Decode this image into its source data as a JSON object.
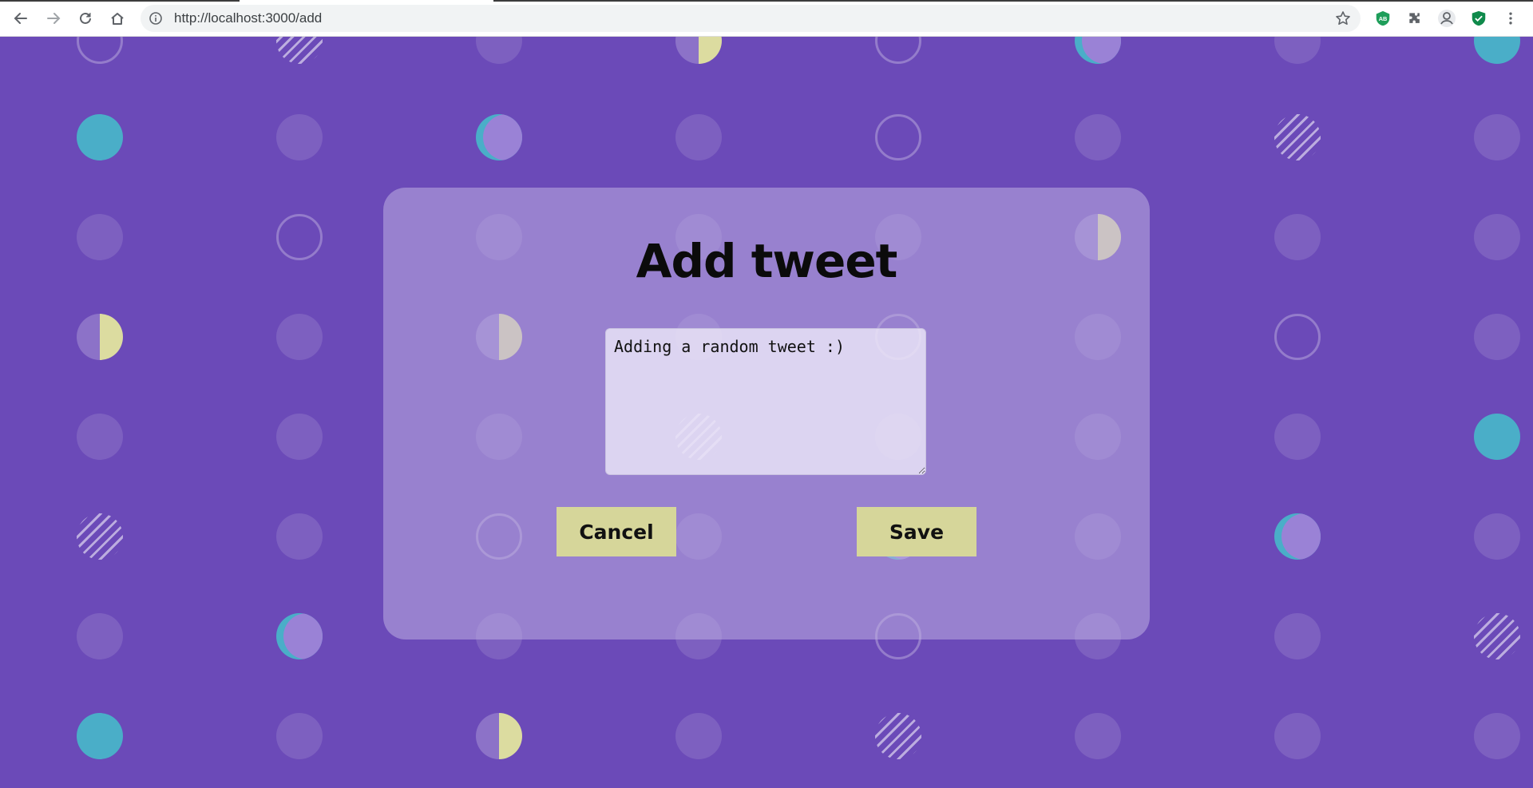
{
  "browser": {
    "url_host": "http://localhost:",
    "url_rest": "3000/add",
    "icons": [
      "back-icon",
      "forward-icon",
      "reload-icon",
      "home-icon",
      "info-icon",
      "star-icon",
      "adblock-icon",
      "extensions-icon",
      "profile-icon",
      "shield-icon",
      "more-icon"
    ],
    "adblock_label": "AB"
  },
  "page": {
    "title": "Add tweet",
    "tweet_text": "Adding a random tweet :)",
    "cancel_label": "Cancel",
    "save_label": "Save"
  },
  "colors": {
    "background": "#6b4ab8",
    "card": "#9a84cf",
    "button": "#d6d69a",
    "teal": "#4aaec8",
    "lemon": "#dcdca0"
  }
}
